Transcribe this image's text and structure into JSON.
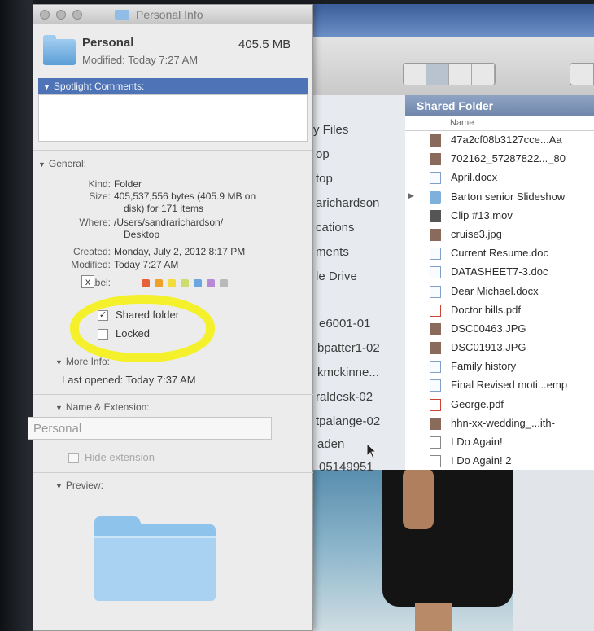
{
  "info_window": {
    "title": "Personal Info",
    "name": "Personal",
    "size": "405.5 MB",
    "modified_header": "Modified: Today 7:27 AM",
    "spotlight_label": "Spotlight Comments:",
    "general_label": "General:",
    "general": {
      "kind_key": "Kind:",
      "kind": "Folder",
      "size_key": "Size:",
      "size_line1": "405,537,556 bytes (405.9 MB on",
      "size_line2": "disk) for 171 items",
      "where_key": "Where:",
      "where_line1": "/Users/sandrarichardson/",
      "where_line2": "Desktop",
      "created_key": "Created:",
      "created": "Monday, July 2, 2012 8:17 PM",
      "modified_key": "Modified:",
      "modified": "Today 7:27 AM",
      "label_key": "Label:",
      "label_clear": "x",
      "shared_folder_label": "Shared folder",
      "shared_folder_checked": true,
      "locked_label": "Locked",
      "locked_checked": false,
      "label_colors": [
        "#e8603a",
        "#f0a02a",
        "#f2dd3c",
        "#cfdc6e",
        "#6aa6e0",
        "#b88ad6",
        "#b9b9b9"
      ]
    },
    "more_info_label": "More Info:",
    "last_opened": "Last opened: Today 7:37 AM",
    "name_ext_label": "Name & Extension:",
    "name_field_value": "Personal",
    "hide_extension_label": "Hide extension",
    "preview_label": "Preview:",
    "highlight_color": "#f6f20a"
  },
  "finder": {
    "sidebar_items": [
      "y Files",
      "op",
      "top",
      "arichardson",
      "cations",
      "ments",
      "le Drive",
      "e6001-01",
      "bpatter1-02",
      "kmckinne...",
      "raldesk-02",
      "tpalange-02",
      "aden",
      "05149951"
    ],
    "content_header": "Shared Folder",
    "name_column": "Name",
    "files": [
      {
        "name": "47a2cf08b3127cce...Aa",
        "icon": "image",
        "disclosure": ""
      },
      {
        "name": "702162_57287822..._80",
        "icon": "image",
        "disclosure": ""
      },
      {
        "name": "April.docx",
        "icon": "document",
        "disclosure": ""
      },
      {
        "name": "Barton senior Slideshow",
        "icon": "folder",
        "disclosure": "▶"
      },
      {
        "name": "Clip #13.mov",
        "icon": "movie",
        "disclosure": ""
      },
      {
        "name": "cruise3.jpg",
        "icon": "image",
        "disclosure": ""
      },
      {
        "name": "Current Resume.doc",
        "icon": "document",
        "disclosure": ""
      },
      {
        "name": "DATASHEET7-3.doc",
        "icon": "document",
        "disclosure": ""
      },
      {
        "name": "Dear Michael.docx",
        "icon": "document",
        "disclosure": ""
      },
      {
        "name": "Doctor bills.pdf",
        "icon": "pdf",
        "disclosure": ""
      },
      {
        "name": "DSC00463.JPG",
        "icon": "image",
        "disclosure": ""
      },
      {
        "name": "DSC01913.JPG",
        "icon": "image",
        "disclosure": ""
      },
      {
        "name": "Family history",
        "icon": "document",
        "disclosure": ""
      },
      {
        "name": "Final Revised moti...emp",
        "icon": "document",
        "disclosure": ""
      },
      {
        "name": "George.pdf",
        "icon": "pdf",
        "disclosure": ""
      },
      {
        "name": "hhn-xx-wedding_...ith-",
        "icon": "image",
        "disclosure": ""
      },
      {
        "name": "I Do Again!",
        "icon": "music",
        "disclosure": ""
      },
      {
        "name": "I Do Again! 2",
        "icon": "music",
        "disclosure": ""
      }
    ]
  }
}
